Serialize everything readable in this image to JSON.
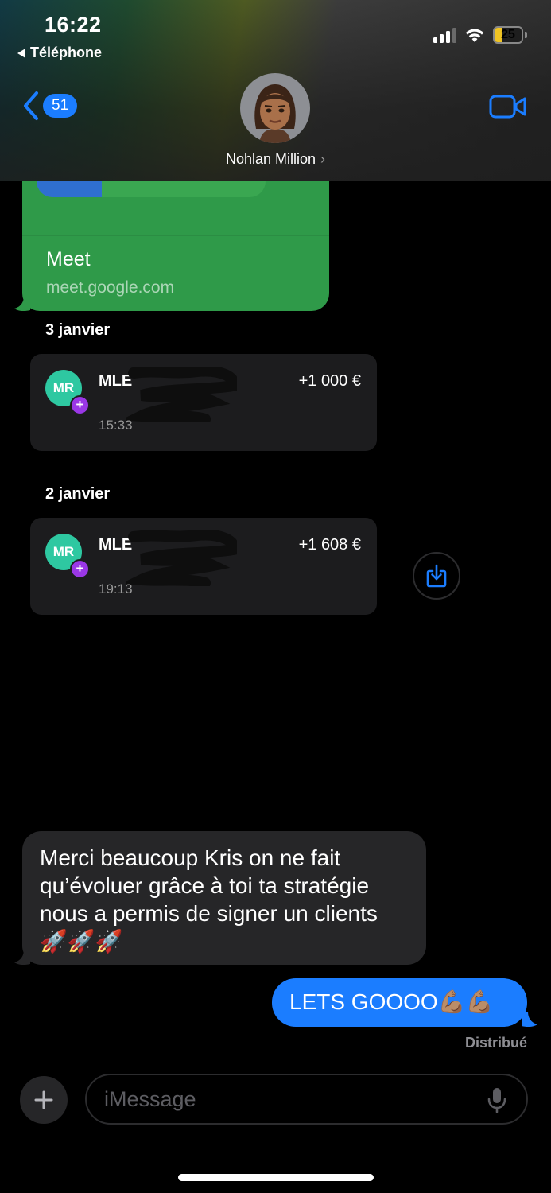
{
  "status_bar": {
    "time": "16:22",
    "back_app": "Téléphone",
    "battery": "25",
    "battery_level_percent": 25,
    "battery_color": "#f0c423"
  },
  "header": {
    "unread_count": "51",
    "contact_name": "Nohlan Million",
    "chevron": "›",
    "avatar_icon": "memoji-avatar-icon",
    "video_icon": "video-camera-icon"
  },
  "link_preview": {
    "title": "Meet",
    "url": "meet.google.com",
    "color": "#2f9a49"
  },
  "transactions": [
    {
      "date": "3 janvier",
      "initials": "MR",
      "name": "MLE",
      "amount": "+1 000 €",
      "time": "15:33"
    },
    {
      "date": "2 janvier",
      "initials": "MR",
      "name": "MLE",
      "amount": "+1 608 €",
      "time": "19:13"
    }
  ],
  "messages": {
    "incoming_text": "Merci beaucoup Kris on ne fait qu’évoluer grâce à toi ta stratégie nous a permis de signer un clients 🚀🚀🚀",
    "outgoing_text": "LETS GOOOO💪🏽💪🏽",
    "status": "Distribué"
  },
  "composer": {
    "placeholder": "iMessage"
  },
  "colors": {
    "accent": "#1b7dff",
    "incoming_bubble": "#262628",
    "avatar_mr": "#2ec8a1",
    "plus_badge": "#9a37e6"
  }
}
